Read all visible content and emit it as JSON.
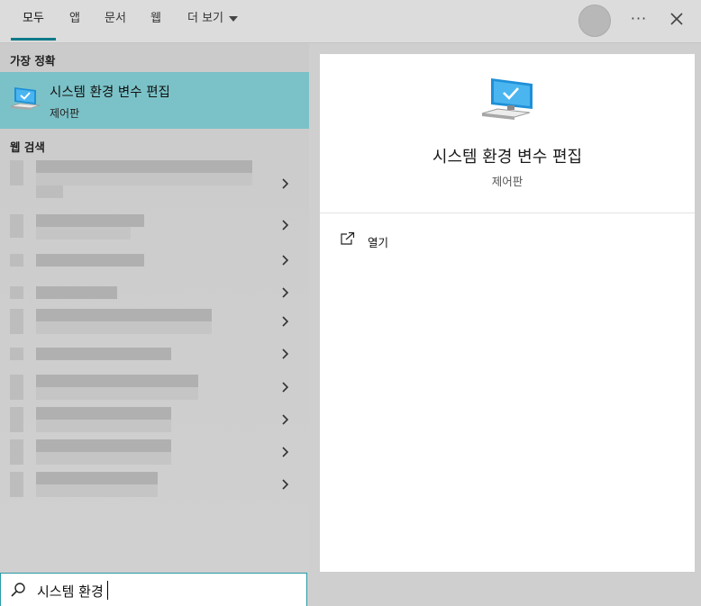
{
  "tabs": [
    {
      "label": "모두",
      "active": true
    },
    {
      "label": "앱",
      "active": false
    },
    {
      "label": "문서",
      "active": false
    },
    {
      "label": "웹",
      "active": false
    },
    {
      "label": "더 보기",
      "active": false
    }
  ],
  "window_buttons": {
    "more": "···"
  },
  "results": {
    "best_match_label": "가장 정확",
    "best_match": {
      "title": "시스템 환경 변수 편집",
      "subtitle": "제어판",
      "icon": "system-monitor-icon"
    },
    "web_label": "웹 검색"
  },
  "detail": {
    "title": "시스템 환경 변수 편집",
    "subtitle": "제어판",
    "icon": "system-monitor-icon",
    "actions": [
      {
        "label": "열기",
        "icon": "open-external-icon"
      }
    ]
  },
  "search": {
    "value": "시스템 환경",
    "icon": "search-icon"
  },
  "colors": {
    "accent": "#0f7a8a",
    "selected_bg": "#7bc2c8",
    "search_border": "#2a9aa8"
  }
}
